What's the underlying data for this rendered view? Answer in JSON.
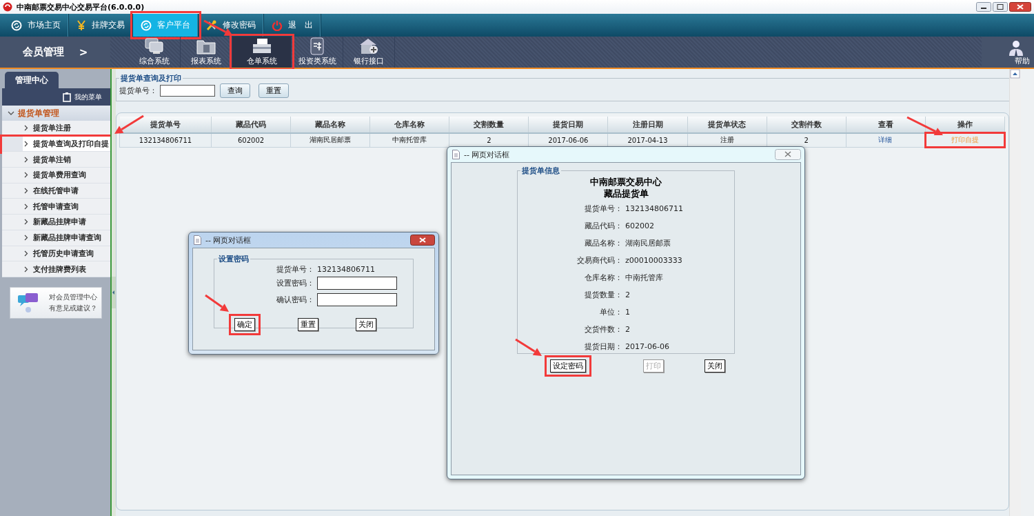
{
  "window": {
    "title": "中南邮票交易中心交易平台(6.0.0.0)"
  },
  "top_nav": [
    {
      "label": "市场主页",
      "kind": "swirl",
      "selected": false,
      "highlighted": false
    },
    {
      "label": "挂牌交易",
      "kind": "yen",
      "selected": false,
      "highlighted": false
    },
    {
      "label": "客户平台",
      "kind": "swirl",
      "selected": true,
      "highlighted": true
    },
    {
      "label": "修改密码",
      "kind": "tools",
      "selected": false,
      "highlighted": false
    },
    {
      "label": "退　出",
      "kind": "power",
      "selected": false,
      "highlighted": false
    }
  ],
  "module_bar": {
    "section": "会员管理",
    "section_arrow": ">",
    "help": "帮助",
    "modules": [
      {
        "label": "综合系统",
        "kind": "monitors",
        "selected": false,
        "highlighted": false
      },
      {
        "label": "报表系统",
        "kind": "folder",
        "selected": false,
        "highlighted": false
      },
      {
        "label": "仓单系统",
        "kind": "tray",
        "selected": true,
        "highlighted": true
      },
      {
        "label": "投资类系统",
        "kind": "money",
        "selected": false,
        "highlighted": false
      },
      {
        "label": "银行接口",
        "kind": "bank",
        "selected": false,
        "highlighted": false
      }
    ]
  },
  "sidebar": {
    "tab": "管理中心",
    "my_menu": "我的菜单",
    "group": {
      "label": "提货单管理",
      "expanded": true,
      "items": [
        {
          "label": "提货单注册",
          "selected": false,
          "highlighted": false
        },
        {
          "label": "提货单查询及打印自提",
          "selected": true,
          "highlighted": true
        },
        {
          "label": "提货单注销",
          "selected": false,
          "highlighted": false
        },
        {
          "label": "提货单费用查询",
          "selected": false,
          "highlighted": false
        },
        {
          "label": "在线托管申请",
          "selected": false,
          "highlighted": false
        },
        {
          "label": "托管申请查询",
          "selected": false,
          "highlighted": false
        },
        {
          "label": "新藏品挂牌申请",
          "selected": false,
          "highlighted": false
        },
        {
          "label": "新藏品挂牌申请查询",
          "selected": false,
          "highlighted": false
        },
        {
          "label": "托管历史申请查询",
          "selected": false,
          "highlighted": false
        },
        {
          "label": "支付挂牌费列表",
          "selected": false,
          "highlighted": false
        }
      ]
    },
    "feedback": "对会员管理中心有意见或建议？"
  },
  "query": {
    "legend": "提货单查询及打印",
    "label": "提货单号：",
    "search_button": "查询",
    "reset_button": "重置"
  },
  "table": {
    "columns": [
      "提货单号",
      "藏品代码",
      "藏品名称",
      "仓库名称",
      "交割数量",
      "提货日期",
      "注册日期",
      "提货单状态",
      "交割件数",
      "查看",
      "操作"
    ],
    "rows": [
      {
        "cells": [
          "132134806711",
          "602002",
          "湖南民居邮票",
          "中南托管库",
          "2",
          "2017-06-06",
          "2017-04-13",
          "注册",
          "2"
        ],
        "view_link": "详细",
        "action": "打印自提",
        "action_highlighted": true
      }
    ]
  },
  "dialogs": [
    {
      "kind": "form",
      "title": "-- 网页对话框",
      "legend": "设置密码",
      "fields": [
        {
          "label": "提货单号：",
          "kind": "text",
          "value": "132134806711"
        },
        {
          "label": "设置密码：",
          "kind": "input"
        },
        {
          "label": "确认密码：",
          "kind": "input"
        }
      ],
      "buttons": [
        {
          "label": "确定",
          "highlighted": true,
          "disabled": false
        },
        {
          "label": "重置",
          "highlighted": false,
          "disabled": false
        },
        {
          "label": "关闭",
          "highlighted": false,
          "disabled": false
        }
      ]
    },
    {
      "kind": "receipt",
      "title": "-- 网页对话框",
      "legend": "提货单信息",
      "heading": [
        "中南邮票交易中心",
        "藏品提货单"
      ],
      "fields": [
        {
          "label": "提货单号：",
          "kind": "text",
          "value": "132134806711"
        },
        {
          "label": "藏品代码：",
          "kind": "text",
          "value": "602002"
        },
        {
          "label": "藏品名称：",
          "kind": "text",
          "value": "湖南民居邮票"
        },
        {
          "label": "交易商代码：",
          "kind": "text",
          "value": "z00010003333"
        },
        {
          "label": "仓库名称：",
          "kind": "text",
          "value": "中南托管库"
        },
        {
          "label": "提货数量：",
          "kind": "text",
          "value": "2"
        },
        {
          "label": "单位：",
          "kind": "text",
          "value": "1"
        },
        {
          "label": "交货件数：",
          "kind": "text",
          "value": "2"
        },
        {
          "label": "提货日期：",
          "kind": "text",
          "value": "2017-06-06"
        }
      ],
      "buttons": [
        {
          "label": "设定密码",
          "highlighted": true,
          "disabled": false
        },
        {
          "label": "打印",
          "highlighted": false,
          "disabled": true
        },
        {
          "label": "关闭",
          "highlighted": false,
          "disabled": false
        }
      ]
    }
  ]
}
